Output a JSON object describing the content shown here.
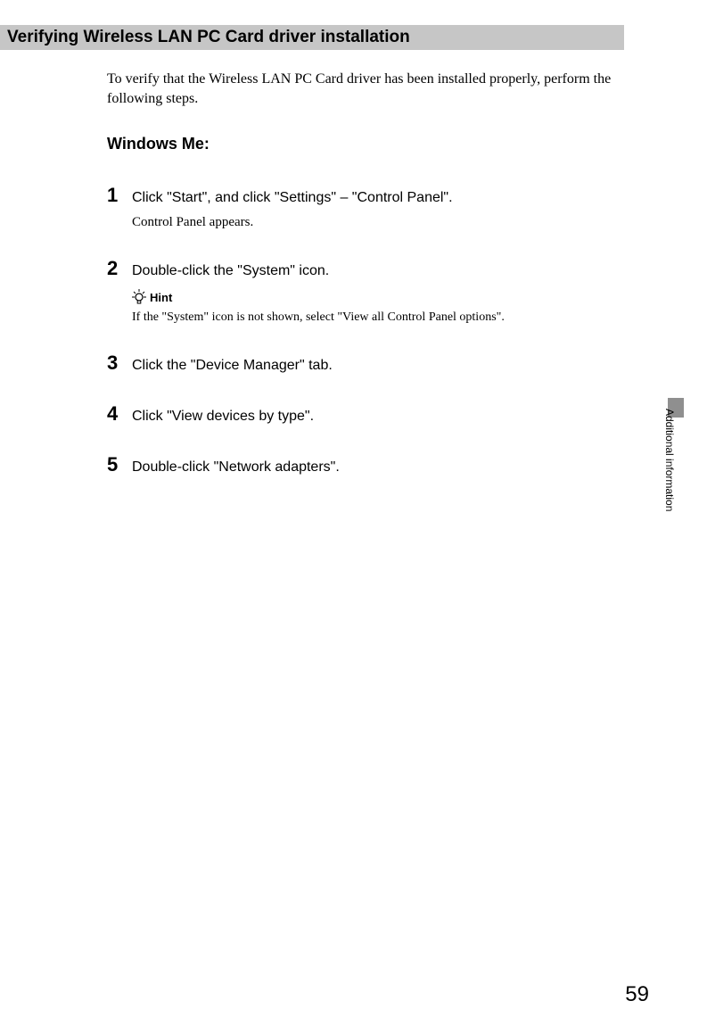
{
  "title": "Verifying Wireless LAN PC Card driver installation",
  "intro": "To verify that the Wireless LAN PC Card driver has been installed properly, perform the following steps.",
  "subhead": "Windows Me:",
  "steps": [
    {
      "num": "1",
      "text": "Click \"Start\", and click \"Settings\" – \"Control Panel\".",
      "sub": "Control Panel appears."
    },
    {
      "num": "2",
      "text": "Double-click the \"System\" icon.",
      "hint_label": "Hint",
      "hint_text": "If the \"System\" icon is not shown, select \"View all Control Panel options\"."
    },
    {
      "num": "3",
      "text": "Click the \"Device Manager\" tab."
    },
    {
      "num": "4",
      "text": "Click \"View devices by type\"."
    },
    {
      "num": "5",
      "text": "Double-click \"Network adapters\"."
    }
  ],
  "side_label": "Additional information",
  "page_number": "59"
}
